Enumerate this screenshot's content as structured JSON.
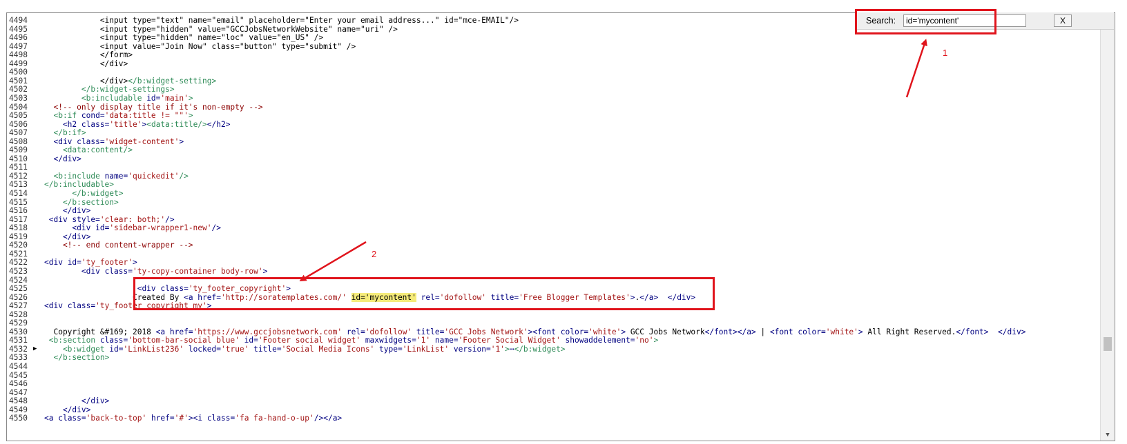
{
  "search": {
    "label": "Search:",
    "value": "id='mycontent'",
    "close_label": "X"
  },
  "annotations": {
    "one": "1",
    "two": "2",
    "color": "#e0141c"
  },
  "lines": [
    {
      "n": "4494",
      "parts": [
        {
          "c": "t",
          "s": "            &lt;input type=&quot;text&quot; name=&quot;email&quot; placeholder=&quot;Enter your email address...&quot; id=&quot;mce-EMAIL&quot;/&gt;"
        }
      ]
    },
    {
      "n": "4495",
      "parts": [
        {
          "c": "t",
          "s": "            &lt;input type=&quot;hidden&quot; value=&quot;GCCJobsNetworkWebsite&quot; name=&quot;uri&quot; /&gt;"
        }
      ]
    },
    {
      "n": "4496",
      "parts": [
        {
          "c": "t",
          "s": "            &lt;input type=&quot;hidden&quot; name=&quot;loc&quot; value=&quot;en_US&quot; /&gt;"
        }
      ]
    },
    {
      "n": "4497",
      "parts": [
        {
          "c": "t",
          "s": "            &lt;input value=&quot;Join Now&quot; class=&quot;button&quot; type=&quot;submit&quot; /&gt;"
        }
      ]
    },
    {
      "n": "4498",
      "parts": [
        {
          "c": "t",
          "s": "            &lt;/form&gt;"
        }
      ]
    },
    {
      "n": "4499",
      "parts": [
        {
          "c": "t",
          "s": "            &lt;/div&gt;"
        }
      ]
    },
    {
      "n": "4500",
      "parts": []
    },
    {
      "n": "4501",
      "parts": [
        {
          "c": "t",
          "s": "            &lt;/div&gt;"
        },
        {
          "c": "g",
          "s": "</b:widget-setting>"
        }
      ]
    },
    {
      "n": "4502",
      "parts": [
        {
          "c": "g",
          "s": "        </b:widget-settings>"
        }
      ]
    },
    {
      "n": "4503",
      "parts": [
        {
          "c": "g",
          "s": "        <b:includable "
        },
        {
          "c": "a",
          "s": "id="
        },
        {
          "c": "v",
          "s": "'main'"
        },
        {
          "c": "g",
          "s": ">"
        }
      ]
    },
    {
      "n": "4504",
      "parts": [
        {
          "c": "c",
          "s": "  <!-- only display title if it's non-empty -->"
        }
      ]
    },
    {
      "n": "4505",
      "parts": [
        {
          "c": "g",
          "s": "  <b:if "
        },
        {
          "c": "a",
          "s": "cond="
        },
        {
          "c": "v",
          "s": "'data:title != &quot;&quot;'"
        },
        {
          "c": "g",
          "s": ">"
        }
      ]
    },
    {
      "n": "4506",
      "parts": [
        {
          "c": "k",
          "s": "    <h2 "
        },
        {
          "c": "a",
          "s": "class="
        },
        {
          "c": "v",
          "s": "'title'"
        },
        {
          "c": "k",
          "s": ">"
        },
        {
          "c": "g",
          "s": "<data:title/>"
        },
        {
          "c": "k",
          "s": "</h2>"
        }
      ]
    },
    {
      "n": "4507",
      "parts": [
        {
          "c": "g",
          "s": "  </b:if>"
        }
      ]
    },
    {
      "n": "4508",
      "parts": [
        {
          "c": "k",
          "s": "  <div "
        },
        {
          "c": "a",
          "s": "class="
        },
        {
          "c": "v",
          "s": "'widget-content'"
        },
        {
          "c": "k",
          "s": ">"
        }
      ]
    },
    {
      "n": "4509",
      "parts": [
        {
          "c": "g",
          "s": "    <data:content/>"
        }
      ]
    },
    {
      "n": "4510",
      "parts": [
        {
          "c": "k",
          "s": "  </div>"
        }
      ]
    },
    {
      "n": "4511",
      "parts": []
    },
    {
      "n": "4512",
      "parts": [
        {
          "c": "g",
          "s": "  <b:include "
        },
        {
          "c": "a",
          "s": "name="
        },
        {
          "c": "v",
          "s": "'quickedit'"
        },
        {
          "c": "g",
          "s": "/>"
        }
      ]
    },
    {
      "n": "4513",
      "parts": [
        {
          "c": "g",
          "s": "</b:includable>"
        }
      ]
    },
    {
      "n": "4514",
      "parts": [
        {
          "c": "g",
          "s": "      </b:widget>"
        }
      ]
    },
    {
      "n": "4515",
      "parts": [
        {
          "c": "g",
          "s": "    </b:section>"
        }
      ]
    },
    {
      "n": "4516",
      "parts": [
        {
          "c": "k",
          "s": "    </div>"
        }
      ]
    },
    {
      "n": "4517",
      "parts": [
        {
          "c": "k",
          "s": " <div "
        },
        {
          "c": "a",
          "s": "style="
        },
        {
          "c": "v",
          "s": "'clear: both;'"
        },
        {
          "c": "k",
          "s": "/>"
        }
      ]
    },
    {
      "n": "4518",
      "parts": [
        {
          "c": "k",
          "s": "      <div "
        },
        {
          "c": "a",
          "s": "id="
        },
        {
          "c": "v",
          "s": "'sidebar-wrapper1-new'"
        },
        {
          "c": "k",
          "s": "/>"
        }
      ]
    },
    {
      "n": "4519",
      "parts": [
        {
          "c": "k",
          "s": "    </div>"
        }
      ]
    },
    {
      "n": "4520",
      "parts": [
        {
          "c": "c",
          "s": "    <!-- end content-wrapper -->"
        }
      ]
    },
    {
      "n": "4521",
      "parts": []
    },
    {
      "n": "4522",
      "parts": [
        {
          "c": "k",
          "s": "<div "
        },
        {
          "c": "a",
          "s": "id="
        },
        {
          "c": "v",
          "s": "'ty_footer'"
        },
        {
          "c": "k",
          "s": ">"
        }
      ]
    },
    {
      "n": "4523",
      "parts": [
        {
          "c": "k",
          "s": "        <div "
        },
        {
          "c": "a",
          "s": "class="
        },
        {
          "c": "v",
          "s": "'ty-copy-container body-row'"
        },
        {
          "c": "k",
          "s": ">"
        }
      ]
    },
    {
      "n": "4524",
      "parts": []
    },
    {
      "n": "4525",
      "parts": [
        {
          "c": "k",
          "s": "                    <div "
        },
        {
          "c": "a",
          "s": "class="
        },
        {
          "c": "v",
          "s": "'ty_footer_copyright'"
        },
        {
          "c": "k",
          "s": ">"
        }
      ]
    },
    {
      "n": "4526",
      "parts": [
        {
          "c": "t",
          "s": "                   Created By "
        },
        {
          "c": "k",
          "s": "<a "
        },
        {
          "c": "a",
          "s": "href="
        },
        {
          "c": "v",
          "s": "'http://soratemplates.com/'"
        },
        {
          "c": "t",
          "s": " "
        },
        {
          "c": "hl",
          "s": "id='mycontent'"
        },
        {
          "c": "t",
          "s": " "
        },
        {
          "c": "a",
          "s": "rel="
        },
        {
          "c": "v",
          "s": "'dofollow'"
        },
        {
          "c": "t",
          "s": " "
        },
        {
          "c": "a",
          "s": "title="
        },
        {
          "c": "v",
          "s": "'Free Blogger Templates'"
        },
        {
          "c": "k",
          "s": ">"
        },
        {
          "c": "t",
          "s": "."
        },
        {
          "c": "k",
          "s": "</a>"
        },
        {
          "c": "t",
          "s": "  "
        },
        {
          "c": "k",
          "s": "</div>"
        }
      ]
    },
    {
      "n": "4527",
      "parts": [
        {
          "c": "k",
          "s": "<div "
        },
        {
          "c": "a",
          "s": "class="
        },
        {
          "c": "v",
          "s": "'ty_footer_copyright_my'"
        },
        {
          "c": "k",
          "s": ">"
        }
      ]
    },
    {
      "n": "4528",
      "parts": []
    },
    {
      "n": "4529",
      "parts": []
    },
    {
      "n": "4530",
      "parts": [
        {
          "c": "t",
          "s": "  Copyright &amp;#169; 2018 "
        },
        {
          "c": "k",
          "s": "<a "
        },
        {
          "c": "a",
          "s": "href="
        },
        {
          "c": "v",
          "s": "'https://www.gccjobsnetwork.com'"
        },
        {
          "c": "t",
          "s": " "
        },
        {
          "c": "a",
          "s": "rel="
        },
        {
          "c": "v",
          "s": "'dofollow'"
        },
        {
          "c": "t",
          "s": " "
        },
        {
          "c": "a",
          "s": "title="
        },
        {
          "c": "v",
          "s": "'GCC Jobs Network'"
        },
        {
          "c": "k",
          "s": "><font "
        },
        {
          "c": "a",
          "s": "color="
        },
        {
          "c": "v",
          "s": "'white'"
        },
        {
          "c": "k",
          "s": ">"
        },
        {
          "c": "t",
          "s": " GCC Jobs Network"
        },
        {
          "c": "k",
          "s": "</font></a>"
        },
        {
          "c": "t",
          "s": " | "
        },
        {
          "c": "k",
          "s": "<font "
        },
        {
          "c": "a",
          "s": "color="
        },
        {
          "c": "v",
          "s": "'white'"
        },
        {
          "c": "k",
          "s": ">"
        },
        {
          "c": "t",
          "s": " All Right Reserved."
        },
        {
          "c": "k",
          "s": "</font>"
        },
        {
          "c": "t",
          "s": "  "
        },
        {
          "c": "k",
          "s": "</div>"
        }
      ]
    },
    {
      "n": "4531",
      "parts": [
        {
          "c": "g",
          "s": " <b:section "
        },
        {
          "c": "a",
          "s": "class="
        },
        {
          "c": "v",
          "s": "'bottom-bar-social blue'"
        },
        {
          "c": "t",
          "s": " "
        },
        {
          "c": "a",
          "s": "id="
        },
        {
          "c": "v",
          "s": "'Footer social widget'"
        },
        {
          "c": "t",
          "s": " "
        },
        {
          "c": "a",
          "s": "maxwidgets="
        },
        {
          "c": "v",
          "s": "'1'"
        },
        {
          "c": "t",
          "s": " "
        },
        {
          "c": "a",
          "s": "name="
        },
        {
          "c": "v",
          "s": "'Footer Social Widget'"
        },
        {
          "c": "t",
          "s": " "
        },
        {
          "c": "a",
          "s": "showaddelement="
        },
        {
          "c": "v",
          "s": "'no'"
        },
        {
          "c": "g",
          "s": ">"
        }
      ]
    },
    {
      "n": "4532",
      "fold": true,
      "parts": [
        {
          "c": "g",
          "s": "    <b:widget "
        },
        {
          "c": "a",
          "s": "id="
        },
        {
          "c": "v",
          "s": "'LinkList236'"
        },
        {
          "c": "t",
          "s": " "
        },
        {
          "c": "a",
          "s": "locked="
        },
        {
          "c": "v",
          "s": "'true'"
        },
        {
          "c": "t",
          "s": " "
        },
        {
          "c": "a",
          "s": "title="
        },
        {
          "c": "v",
          "s": "'Social Media Icons'"
        },
        {
          "c": "t",
          "s": " "
        },
        {
          "c": "a",
          "s": "type="
        },
        {
          "c": "v",
          "s": "'LinkList'"
        },
        {
          "c": "t",
          "s": " "
        },
        {
          "c": "a",
          "s": "version="
        },
        {
          "c": "v",
          "s": "'1'"
        },
        {
          "c": "g",
          "s": ">"
        },
        {
          "c": "k",
          "s": "⋯"
        },
        {
          "c": "g",
          "s": "</b:widget>"
        }
      ]
    },
    {
      "n": "4533",
      "parts": [
        {
          "c": "g",
          "s": "  </b:section>"
        }
      ]
    },
    {
      "n": "4544",
      "parts": []
    },
    {
      "n": "4545",
      "parts": []
    },
    {
      "n": "4546",
      "parts": []
    },
    {
      "n": "4547",
      "parts": []
    },
    {
      "n": "4548",
      "parts": [
        {
          "c": "k",
          "s": "        </div>"
        }
      ]
    },
    {
      "n": "4549",
      "parts": [
        {
          "c": "k",
          "s": "    </div>"
        }
      ]
    },
    {
      "n": "4550",
      "parts": [
        {
          "c": "k",
          "s": "<a "
        },
        {
          "c": "a",
          "s": "class="
        },
        {
          "c": "v",
          "s": "'back-to-top'"
        },
        {
          "c": "t",
          "s": " "
        },
        {
          "c": "a",
          "s": "href="
        },
        {
          "c": "v",
          "s": "'#'"
        },
        {
          "c": "k",
          "s": "><i "
        },
        {
          "c": "a",
          "s": "class="
        },
        {
          "c": "v",
          "s": "'fa fa-hand-o-up'"
        },
        {
          "c": "k",
          "s": "/></a>"
        }
      ]
    }
  ]
}
